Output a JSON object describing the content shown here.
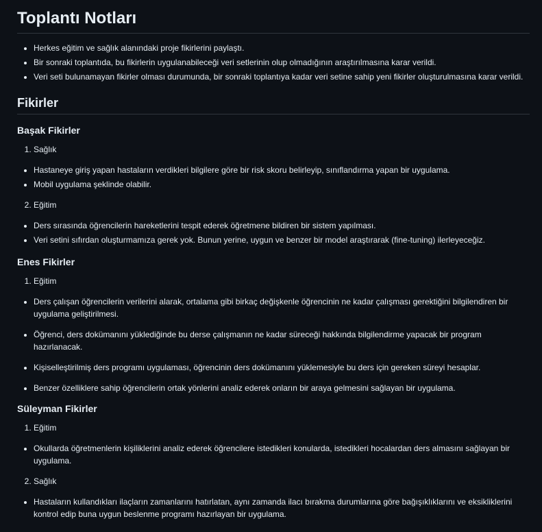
{
  "title": "Toplantı Notları",
  "summary": [
    "Herkes eğitim ve sağlık alanındaki proje fikirlerini paylaştı.",
    "Bir sonraki toplantıda, bu fikirlerin uygulanabileceği veri setlerinin olup olmadığının araştırılmasına karar verildi.",
    "Veri seti bulunamayan fikirler olması durumunda, bir sonraki toplantıya kadar veri setine sahip yeni fikirler oluşturulmasına karar verildi."
  ],
  "ideas_heading": "Fikirler",
  "basak": {
    "heading": "Başak Fikirler",
    "cat1": "Sağlık",
    "cat1_items": [
      "Hastaneye giriş yapan hastaların verdikleri bilgilere göre bir risk skoru belirleyip, sınıflandırma yapan bir uygulama.",
      "Mobil uygulama şeklinde olabilir."
    ],
    "cat2": "Eğitim",
    "cat2_items": [
      "Ders sırasında öğrencilerin hareketlerini tespit ederek öğretmene bildiren bir sistem yapılması.",
      "Veri setini sıfırdan oluşturmamıza gerek yok. Bunun yerine, uygun ve benzer bir model araştırarak (fine-tuning) ilerleyeceğiz."
    ]
  },
  "enes": {
    "heading": "Enes Fikirler",
    "cat1": "Eğitim",
    "cat1_items": [
      "Ders çalışan öğrencilerin verilerini alarak, ortalama gibi birkaç değişkenle öğrencinin ne kadar çalışması gerektiğini bilgilendiren bir uygulama geliştirilmesi.",
      "Öğrenci, ders dokümanını yüklediğinde bu derse çalışmanın ne kadar süreceği hakkında bilgilendirme yapacak bir program hazırlanacak.",
      "Kişiselleştirilmiş ders programı uygulaması, öğrencinin ders dokümanını yüklemesiyle bu ders için gereken süreyi hesaplar.",
      "Benzer özelliklere sahip öğrencilerin ortak yönlerini analiz ederek onların bir araya gelmesini sağlayan bir uygulama."
    ]
  },
  "suleyman": {
    "heading": "Süleyman Fikirler",
    "cat1": "Eğitim",
    "cat1_items": [
      "Okullarda öğretmenlerin kişiliklerini analiz ederek öğrencilere istedikleri konularda, istedikleri hocalardan ders almasını sağlayan bir uygulama."
    ],
    "cat2": "Sağlık",
    "cat2_items": [
      "Hastaların kullandıkları ilaçların zamanlarını hatırlatan, aynı zamanda ilacı bırakma durumlarına göre bağışıklıklarını ve eksikliklerini kontrol edip buna uygun beslenme programı hazırlayan bir uygulama."
    ]
  }
}
